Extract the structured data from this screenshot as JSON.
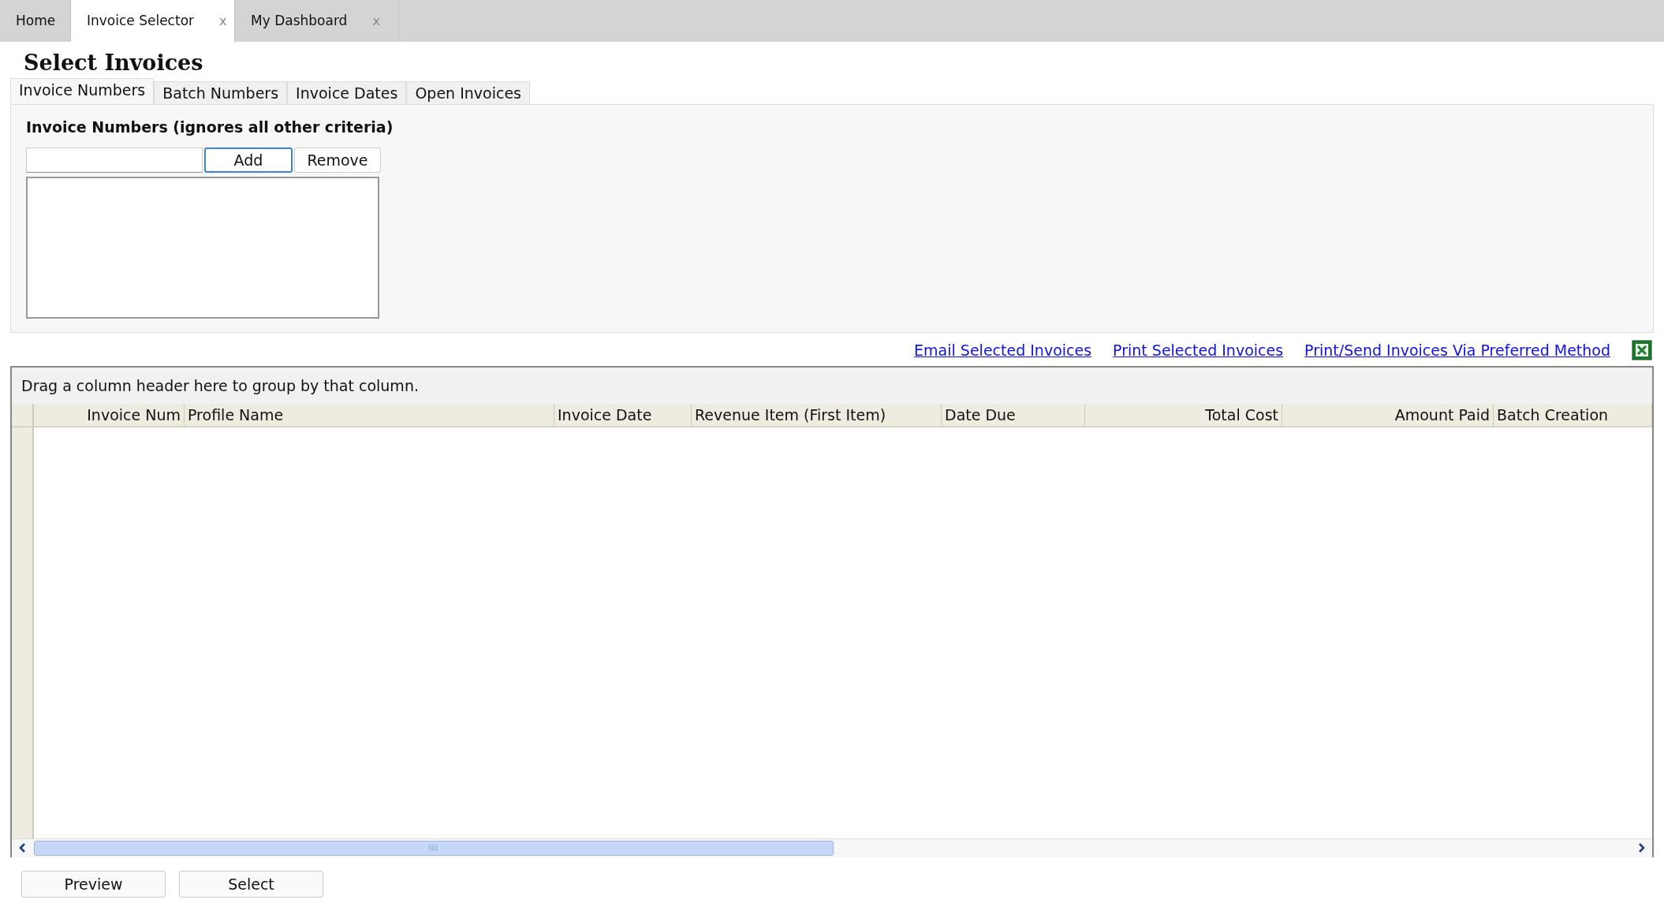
{
  "app_tabs": [
    {
      "label": "Home",
      "selected": false
    },
    {
      "label": "Invoice Selector",
      "selected": true,
      "close": "x"
    },
    {
      "label": "My Dashboard",
      "selected": false,
      "close": "x"
    }
  ],
  "title": "Select Invoices",
  "criteria_tabs": [
    {
      "label": "Invoice Numbers",
      "selected": true
    },
    {
      "label": "Batch Numbers",
      "selected": false
    },
    {
      "label": "Invoice Dates",
      "selected": false
    },
    {
      "label": "Open Invoices",
      "selected": false
    }
  ],
  "invoice_numbers": {
    "heading": "Invoice Numbers (ignores all other criteria)",
    "add_button": "Add",
    "remove_button": "Remove"
  },
  "links": [
    "Email Selected Invoices",
    "Print Selected Invoices",
    "Print/Send Invoices Via Preferred Method"
  ],
  "grid": {
    "group_hint": "Drag a column header here to group by that column.",
    "columns": [
      {
        "label": "Invoice Num",
        "kind": "numeric"
      },
      {
        "label": "Profile Name",
        "kind": "text"
      },
      {
        "label": "Invoice Date",
        "kind": "text"
      },
      {
        "label": "Revenue Item (First Item)",
        "kind": "text"
      },
      {
        "label": "Date Due",
        "kind": "text"
      },
      {
        "label": "Total Cost",
        "kind": "numeric"
      },
      {
        "label": "Amount Paid",
        "kind": "numeric"
      },
      {
        "label": "Batch Creation",
        "kind": "text"
      }
    ]
  },
  "buttons": [
    "Preview",
    "Select"
  ]
}
